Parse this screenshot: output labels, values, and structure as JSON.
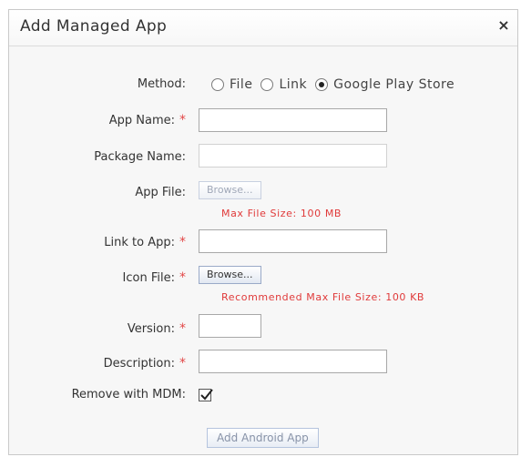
{
  "dialog": {
    "title": "Add Managed App",
    "close_glyph": "×"
  },
  "form": {
    "method_label": "Method:",
    "method_options": [
      "File",
      "Link",
      "Google Play Store"
    ],
    "method_selected": "Google Play Store",
    "app_name_label": "App Name:",
    "app_name_value": "",
    "package_name_label": "Package Name:",
    "package_name_value": "",
    "app_file_label": "App File:",
    "app_file_button": "Browse...",
    "app_file_hint": "Max File Size: 100 MB",
    "link_label": "Link to App:",
    "link_value": "",
    "icon_file_label": "Icon File:",
    "icon_file_button": "Browse...",
    "icon_file_hint": "Recommended Max File Size: 100 KB",
    "version_label": "Version:",
    "version_value": "",
    "description_label": "Description:",
    "description_value": "",
    "remove_label": "Remove with MDM:",
    "remove_checked": true,
    "required_mark": "*",
    "submit_label": "Add Android App"
  },
  "colors": {
    "required": "#e24747",
    "hint": "#e03a3a"
  }
}
